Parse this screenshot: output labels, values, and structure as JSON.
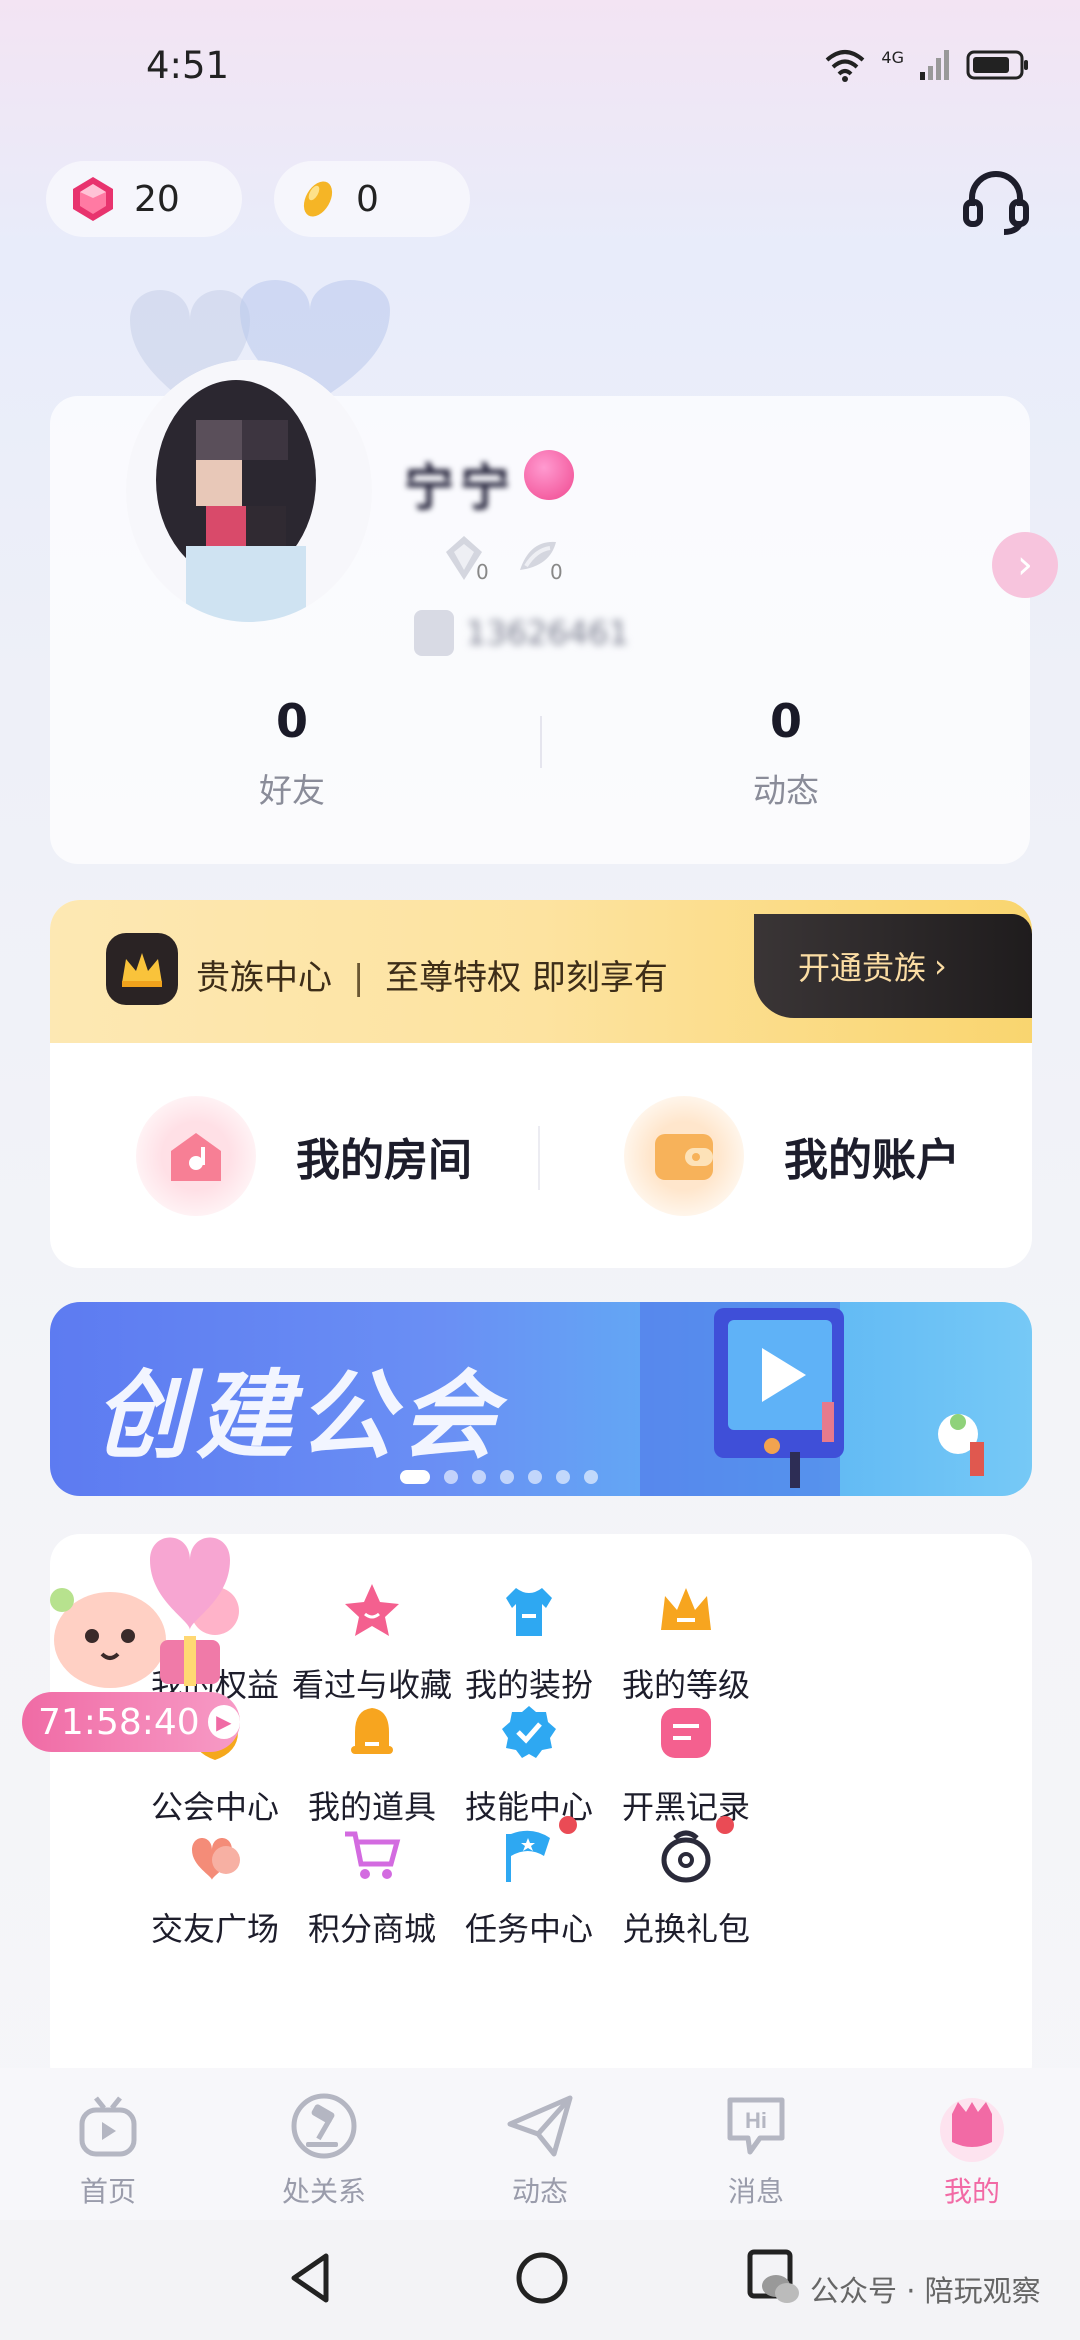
{
  "status_bar": {
    "time": "4:51",
    "network": "4G"
  },
  "currency": {
    "gems": "20",
    "beans": "0"
  },
  "profile": {
    "name": "宁宁",
    "id_text": "13626461",
    "medals": [
      "0",
      "0"
    ],
    "stats": [
      {
        "value": "0",
        "label": "好友"
      },
      {
        "value": "0",
        "label": "动态"
      }
    ]
  },
  "noble": {
    "title": "贵族中心",
    "subtitle": "至尊特权 即刻享有",
    "button": "开通贵族"
  },
  "quick_links": [
    {
      "label": "我的房间"
    },
    {
      "label": "我的账户"
    }
  ],
  "banner": {
    "title": "创建公会",
    "dots": 7,
    "active_dot": 0
  },
  "timer": "71:58:40",
  "grid": [
    {
      "label": "我的权益",
      "icon": "benefit-icon",
      "color": "#ffb3c9"
    },
    {
      "label": "看过与收藏",
      "icon": "star-icon",
      "color": "#f4608f"
    },
    {
      "label": "我的装扮",
      "icon": "shirt-icon",
      "color": "#2ea8f2"
    },
    {
      "label": "我的等级",
      "icon": "crown-icon",
      "color": "#f7a51f"
    },
    {
      "label": "公会中心",
      "icon": "shield-icon",
      "color": "#f5a81c"
    },
    {
      "label": "我的道具",
      "icon": "bell-icon",
      "color": "#f7a51f"
    },
    {
      "label": "技能中心",
      "icon": "badge-check-icon",
      "color": "#2ea8f2"
    },
    {
      "label": "开黑记录",
      "icon": "record-icon",
      "color": "#f4608f"
    },
    {
      "label": "交友广场",
      "icon": "hearts-icon",
      "color": "#f48c78"
    },
    {
      "label": "积分商城",
      "icon": "cart-icon",
      "color": "#d36be0"
    },
    {
      "label": "任务中心",
      "icon": "flag-icon",
      "color": "#2ea8f2"
    },
    {
      "label": "兑换礼包",
      "icon": "gift-bag-icon",
      "color": "#2a2a3a"
    }
  ],
  "tabs": [
    {
      "label": "首页",
      "icon": "tv-icon"
    },
    {
      "label": "处关系",
      "icon": "hammer-icon"
    },
    {
      "label": "动态",
      "icon": "send-icon"
    },
    {
      "label": "消息",
      "icon": "hi-bubble-icon"
    },
    {
      "label": "我的",
      "icon": "mine-icon"
    }
  ],
  "active_tab": 4,
  "watermark": "公众号 · 陪玩观察",
  "colors": {
    "accent": "#f26aa5",
    "tab_inactive": "#9a9cab"
  }
}
